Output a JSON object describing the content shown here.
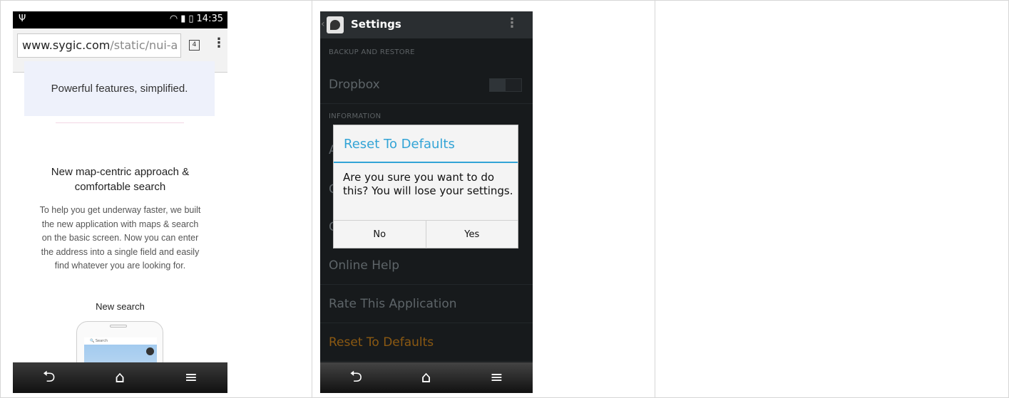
{
  "phone1": {
    "status": {
      "usb_icon": "usb-icon",
      "time": "14:35",
      "battery": "battery-icon",
      "signal": "signal-icon",
      "wifi": "wifi-icon"
    },
    "url": {
      "domain": "www.sygic.com",
      "path": "/static/nui-a"
    },
    "tab_count": "4",
    "hero_text": "Powerful features, simplified.",
    "heading_line1": "New map-centric approach &",
    "heading_line2": "comfortable search",
    "paragraph_lines": [
      "To help you get underway faster, we built",
      "the new application with maps & search",
      "on the basic screen. Now you can enter",
      "the address into a single field and easily",
      "find whatever you are looking for."
    ],
    "subcaption": "New search",
    "mini_search_placeholder": "Search"
  },
  "phone2": {
    "title": "Settings",
    "section_backup": "BACKUP AND RESTORE",
    "dropbox_label": "Dropbox",
    "section_information": "INFORMATION",
    "dialog": {
      "title": "Reset To Defaults",
      "message": "Are you sure you want to do this? You will lose your settings.",
      "no": "No",
      "yes": "Yes"
    },
    "rows": [
      {
        "label": "Online Help"
      },
      {
        "label": "Rate This Application"
      },
      {
        "label": "Reset To Defaults"
      }
    ],
    "accent_color": "#33a4d6",
    "reset_color": "#8b5912"
  }
}
